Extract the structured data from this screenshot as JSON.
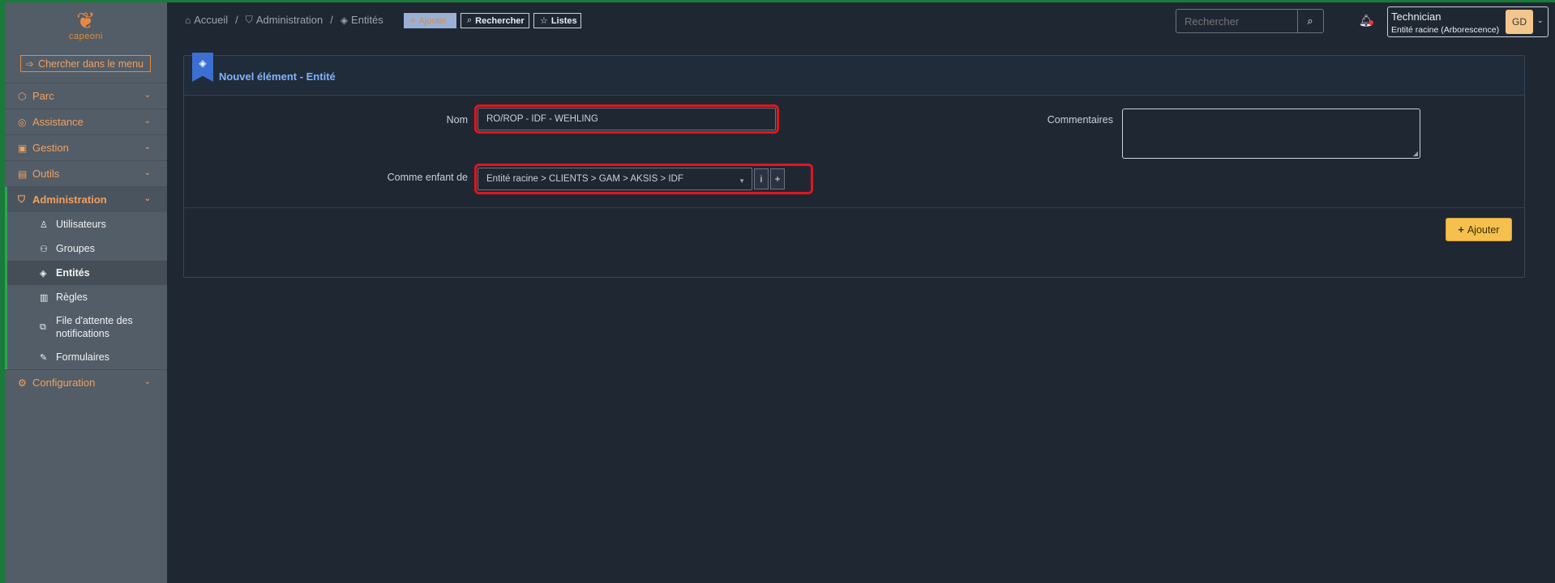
{
  "brand": {
    "logo_text": "capeoni"
  },
  "sidebar": {
    "menu_search_label": "Chercher dans le menu",
    "items": [
      {
        "label": "Parc",
        "icon": "box-icon"
      },
      {
        "label": "Assistance",
        "icon": "headset-icon"
      },
      {
        "label": "Gestion",
        "icon": "wallet-icon"
      },
      {
        "label": "Outils",
        "icon": "briefcase-icon"
      },
      {
        "label": "Administration",
        "icon": "shield-icon"
      },
      {
        "label": "Configuration",
        "icon": "gear-icon"
      }
    ],
    "admin_sub": [
      {
        "label": "Utilisateurs",
        "icon": "user-icon"
      },
      {
        "label": "Groupes",
        "icon": "users-icon"
      },
      {
        "label": "Entités",
        "icon": "stack-icon"
      },
      {
        "label": "Règles",
        "icon": "book-icon"
      },
      {
        "label": "File d'attente des notifications",
        "icon": "queue-icon"
      },
      {
        "label": "Formulaires",
        "icon": "edit-icon"
      }
    ]
  },
  "breadcrumb": {
    "home": "Accueil",
    "section": "Administration",
    "page": "Entités"
  },
  "toolbar": {
    "add_label": "Ajouter",
    "search_label": "Rechercher",
    "lists_label": "Listes"
  },
  "top_search": {
    "placeholder": "Rechercher"
  },
  "user": {
    "name": "Technician",
    "entity": "Entité racine (Arborescence)",
    "initials": "GD"
  },
  "form": {
    "title": "Nouvel élément - Entité",
    "name_label": "Nom",
    "name_value": "RO/ROP - IDF - WEHLING",
    "parent_label": "Comme enfant de",
    "parent_value": "Entité racine > CLIENTS > GAM > AKSIS > IDF",
    "info_btn": "i",
    "plus_btn": "+",
    "comments_label": "Commentaires",
    "comments_value": "",
    "submit_label": "Ajouter"
  },
  "colors": {
    "accent": "#e4893e",
    "highlight": "#e0161c",
    "submit": "#f5c04e",
    "title": "#7fb3ff"
  }
}
